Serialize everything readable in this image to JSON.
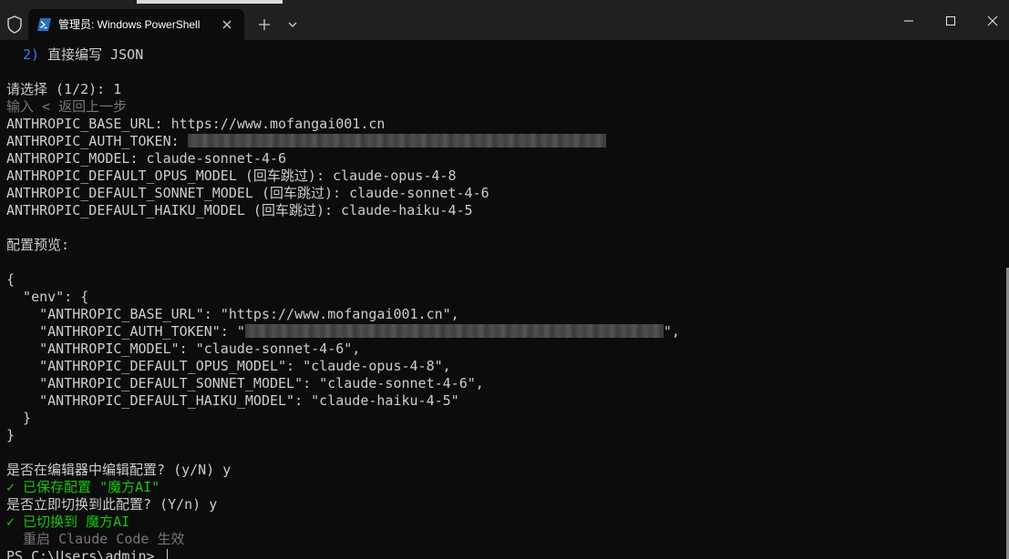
{
  "window": {
    "tab_title": "管理员: Windows PowerShell",
    "new_tab_symbol": "+",
    "icons": {
      "shield": "shield-icon",
      "tab": "powershell-icon",
      "tab_close": "close-icon",
      "new_tab": "plus-icon",
      "dropdown": "chevron-down-icon",
      "minimize": "minimize-icon",
      "maximize": "maximize-icon",
      "close": "close-icon"
    }
  },
  "terminal": {
    "colors": {
      "background": "#0c0c0c",
      "text": "#cccccc",
      "accent_blue": "#3b78ff",
      "success_green": "#16c60c",
      "muted_gray": "#767676"
    },
    "menu_option_number": "2)",
    "menu_option_text": " 直接编写 JSON",
    "select_prompt": "请选择 (1/2): 1",
    "back_hint": "输入 < 返回上一步",
    "base_url_line": "ANTHROPIC_BASE_URL: https://www.mofangai001.cn",
    "auth_token_label": "ANTHROPIC_AUTH_TOKEN: ",
    "model_line": "ANTHROPIC_MODEL: claude-sonnet-4-6",
    "opus_line": "ANTHROPIC_DEFAULT_OPUS_MODEL (回车跳过): claude-opus-4-8",
    "sonnet_line": "ANTHROPIC_DEFAULT_SONNET_MODEL (回车跳过): claude-sonnet-4-6",
    "haiku_line": "ANTHROPIC_DEFAULT_HAIKU_MODEL (回车跳过): claude-haiku-4-5",
    "preview_title": "配置预览:",
    "json_preview": {
      "open_brace": "{",
      "env_open": "  \"env\": {",
      "base_url": "    \"ANTHROPIC_BASE_URL\": \"https://www.mofangai001.cn\",",
      "auth_token_prefix": "    \"ANTHROPIC_AUTH_TOKEN\": \"",
      "auth_token_suffix": "\",",
      "model": "    \"ANTHROPIC_MODEL\": \"claude-sonnet-4-6\",",
      "opus": "    \"ANTHROPIC_DEFAULT_OPUS_MODEL\": \"claude-opus-4-8\",",
      "sonnet": "    \"ANTHROPIC_DEFAULT_SONNET_MODEL\": \"claude-sonnet-4-6\",",
      "haiku": "    \"ANTHROPIC_DEFAULT_HAIKU_MODEL\": \"claude-haiku-4-5\"",
      "env_close": "  }",
      "close_brace": "}"
    },
    "edit_question": "是否在编辑器中编辑配置? (y/N) y",
    "saved_message": "✓ 已保存配置 \"魔方AI\"",
    "switch_question": "是否立即切换到此配置? (Y/n) y",
    "switched_message": "✓ 已切换到 魔方AI",
    "restart_hint": "  重启 Claude Code 生效",
    "shell_prompt": "PS C:\\Users\\admin> "
  }
}
